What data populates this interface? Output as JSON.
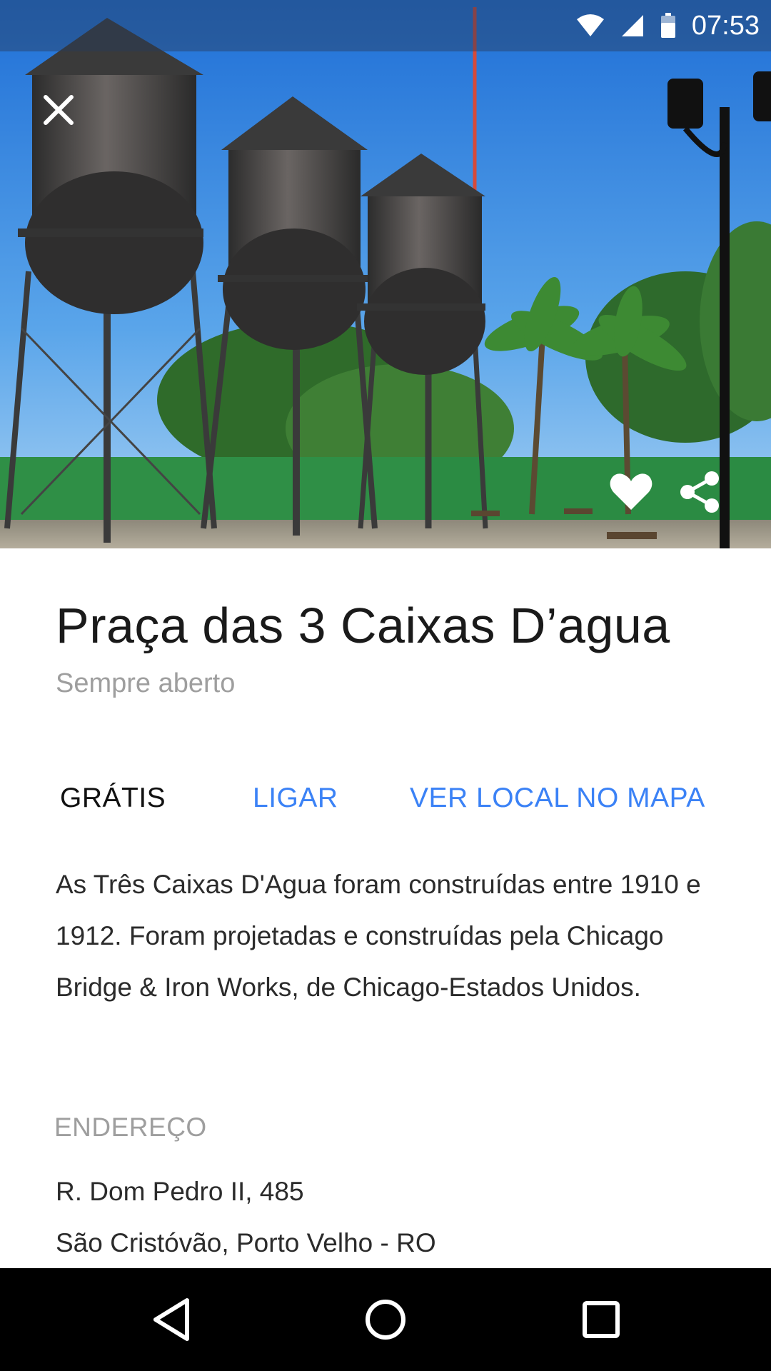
{
  "status_bar": {
    "time": "07:53",
    "icons": [
      "wifi-icon",
      "cell-signal-icon",
      "battery-icon"
    ]
  },
  "hero": {
    "image_description": "Three dark water tanks on tall steel towers in a park, palm trees, green wall, blue sky",
    "close_icon": "close-icon",
    "favorite_icon": "heart-icon",
    "share_icon": "share-icon"
  },
  "place": {
    "title": "Praça das 3 Caixas D’agua",
    "hours": "Sempre aberto"
  },
  "actions": {
    "price": "GRÁTIS",
    "call": "LIGAR",
    "map": "VER LOCAL NO MAPA"
  },
  "description": "As Três Caixas D'Agua foram construídas entre 1910 e 1912. Foram projetadas e construídas pela Chicago Bridge & Iron Works, de Chicago-Estados Unidos.",
  "address": {
    "label": "ENDEREÇO",
    "line1": "R. Dom Pedro II, 485",
    "line2": "São Cristóvão, Porto Velho - RO"
  },
  "colors": {
    "accent": "#3b82f6",
    "text_primary": "#1a1a1a",
    "text_secondary": "#9e9e9e",
    "nav_bar": "#000000"
  },
  "nav_bar": {
    "icons": [
      "back-icon",
      "home-icon",
      "recents-icon"
    ]
  }
}
